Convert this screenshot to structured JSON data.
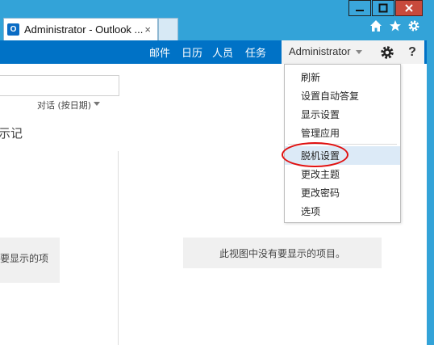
{
  "browser": {
    "tab_title": "Administrator - Outlook ...",
    "tab_close": "×",
    "favicon_letter": "O",
    "window_buttons": {
      "minimize": "—",
      "maximize": "□",
      "close": "✕"
    },
    "toolbar_icons": [
      "home-icon",
      "star-icon",
      "gear-icon"
    ]
  },
  "navbar": {
    "items": [
      {
        "label": "邮件"
      },
      {
        "label": "日历"
      },
      {
        "label": "人员"
      },
      {
        "label": "任务"
      }
    ],
    "user": "Administrator",
    "help": "?",
    "accent_color": "#0072c6"
  },
  "list_pane": {
    "sort_label": "对话 (按日期)",
    "folder_title_fragment": "示记",
    "empty_fragment": "要显示的项"
  },
  "reading_pane": {
    "empty_message": "此视图中没有要显示的项目。"
  },
  "settings_menu": {
    "group1": [
      "刷新",
      "设置自动答复",
      "显示设置",
      "管理应用"
    ],
    "group2": [
      "脱机设置",
      "更改主题",
      "更改密码",
      "选项"
    ],
    "highlighted": "脱机设置",
    "annotation_color": "#e01010"
  }
}
